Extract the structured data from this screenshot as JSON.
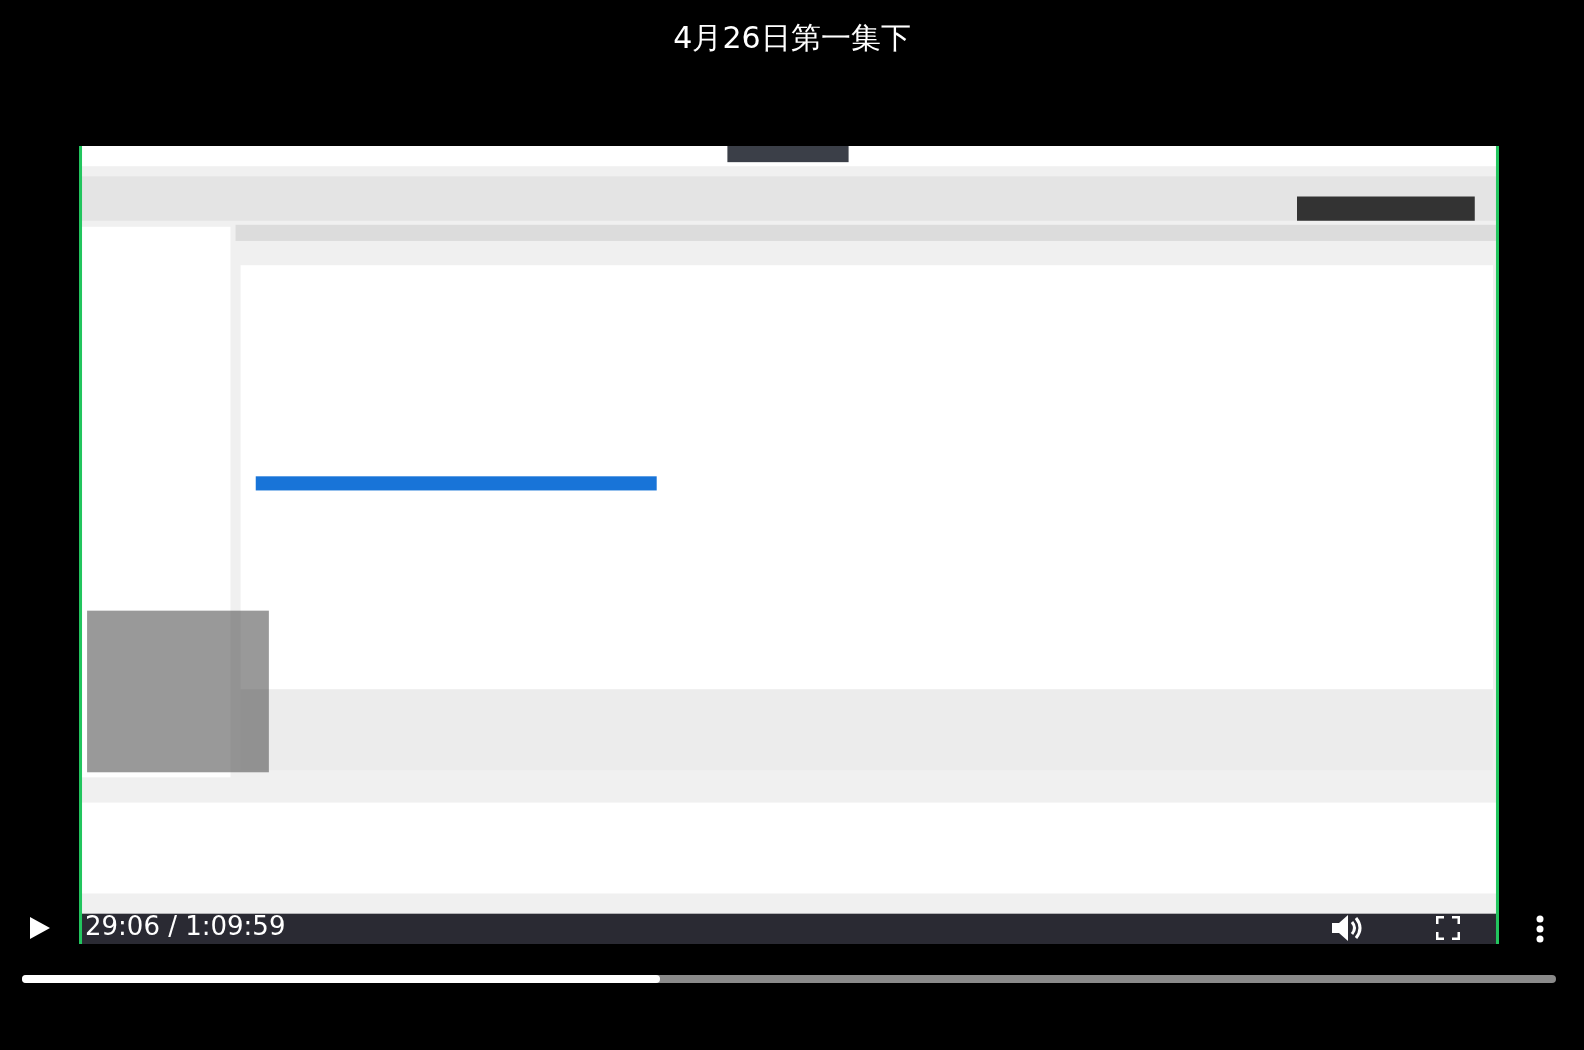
{
  "title": "4月26日第一集下",
  "player": {
    "time": "29:06 / 1:09:59",
    "progress": {
      "level": 0.416
    }
  }
}
